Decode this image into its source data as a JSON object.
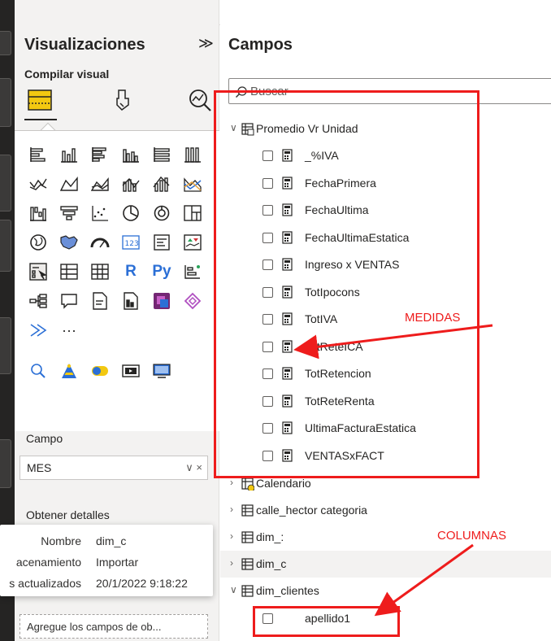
{
  "visualizations": {
    "title": "Visualizaciones",
    "collapse_glyph": "≫",
    "subtitle": "Compilar visual",
    "more_glyph": "···",
    "build_icons": [
      "table-build-icon",
      "format-brush-icon",
      "analytics-magnifier-icon"
    ],
    "visual_icons": [
      "stacked-bar-icon",
      "stacked-column-icon",
      "clustered-bar-icon",
      "clustered-column-icon",
      "100-bar-icon",
      "100-column-icon",
      "line-chart-icon",
      "area-chart-icon",
      "stacked-area-icon",
      "line-column-icon",
      "line-clustered-icon",
      "ribbon-chart-icon",
      "waterfall-icon",
      "funnel-icon",
      "scatter-icon",
      "pie-icon",
      "donut-icon",
      "treemap-icon",
      "map-icon",
      "filled-map-icon",
      "gauge-icon",
      "card-icon",
      "multirow-card-icon",
      "kpi-icon",
      "slicer-icon",
      "table-icon",
      "matrix-icon",
      "r-visual-icon",
      "python-visual-icon",
      "key-influencers-icon",
      "decomposition-tree-icon",
      "qa-icon",
      "narrative-icon",
      "paginated-report-icon",
      "power-apps-icon",
      "power-automate-icon"
    ],
    "custom_icons": [
      "smart-narrative-icon",
      "more-visuals-icon"
    ],
    "r_label": "R",
    "py_label": "Py",
    "card_label": "123",
    "extra_icons": [
      "search-icon",
      "pyramid-icon",
      "toggle-icon",
      "video-icon",
      "monitor-icon"
    ],
    "campo_label": "Campo",
    "campo_value": "MES",
    "campo_controls": "∨ ×",
    "details_label": "Obtener detalles",
    "add_fields_placeholder": "Agregue los campos de ob..."
  },
  "tooltip": {
    "rows": [
      {
        "key": "Nombre",
        "value": "dim_c"
      },
      {
        "key": "acenamiento",
        "value": "Importar"
      },
      {
        "key": "s actualizados",
        "value": "20/1/2022 9:18:22"
      }
    ]
  },
  "fields": {
    "title": "Campos",
    "search_placeholder": "Buscar",
    "table_promedio": "Promedio Vr Unidad",
    "measures": [
      "_%IVA",
      "FechaPrimera",
      "FechaUltima",
      "FechaUltimaEstatica",
      "Ingreso x VENTAS",
      "TotIpocons",
      "TotIVA",
      "TotReteICA",
      "TotRetencion",
      "TotReteRenta",
      "UltimaFacturaEstatica",
      "VENTASxFACT"
    ],
    "tables": [
      "Calendario",
      "calle_hector categoria",
      "dim_:",
      "dim_c",
      "dim_clientes"
    ],
    "column_item": "apellido1"
  },
  "annotations": {
    "medidas": "MEDIDAS",
    "columnas": "COLUMNAS",
    "color": "#ee1c1c"
  },
  "colors": {
    "accent_yellow": "#f2c811",
    "rail": "#252423",
    "pane": "#f3f2f1"
  }
}
